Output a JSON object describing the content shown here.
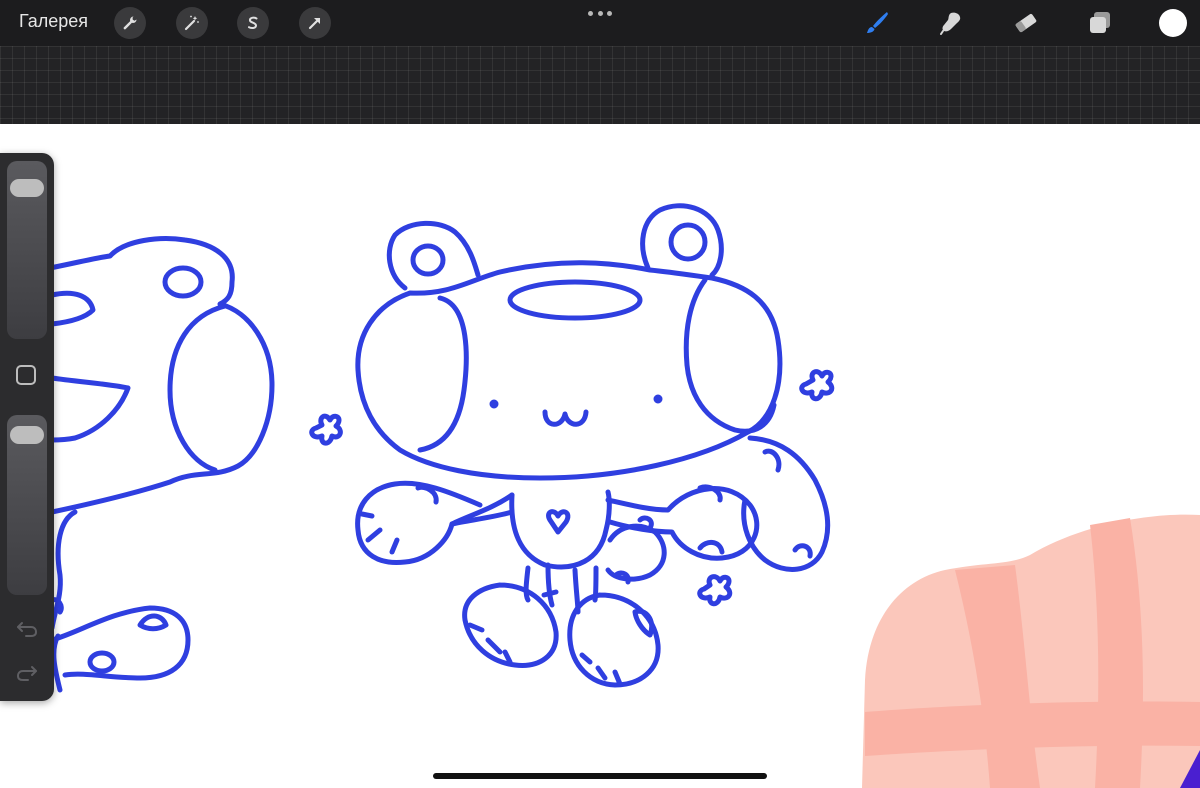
{
  "toolbar": {
    "gallery_label": "Галерея",
    "left_tools": [
      "wrench-icon",
      "magic-wand-icon",
      "selection-s-icon",
      "transform-arrow-icon"
    ],
    "right_tools": [
      "brush-icon",
      "smudge-icon",
      "eraser-icon",
      "layers-icon"
    ],
    "active_tool": "brush-icon",
    "active_color": "#2f7ef0",
    "current_color": "#ffffff"
  },
  "sidebar": {
    "brush_size_level": 0.9,
    "opacity_level": 0.95,
    "icons": [
      "modify-square-icon",
      "undo-icon",
      "redo-icon"
    ]
  },
  "canvas": {
    "background": "#ffffff",
    "stroke_color": "#2f3fe0",
    "blob_color": "#fbb1a6"
  }
}
